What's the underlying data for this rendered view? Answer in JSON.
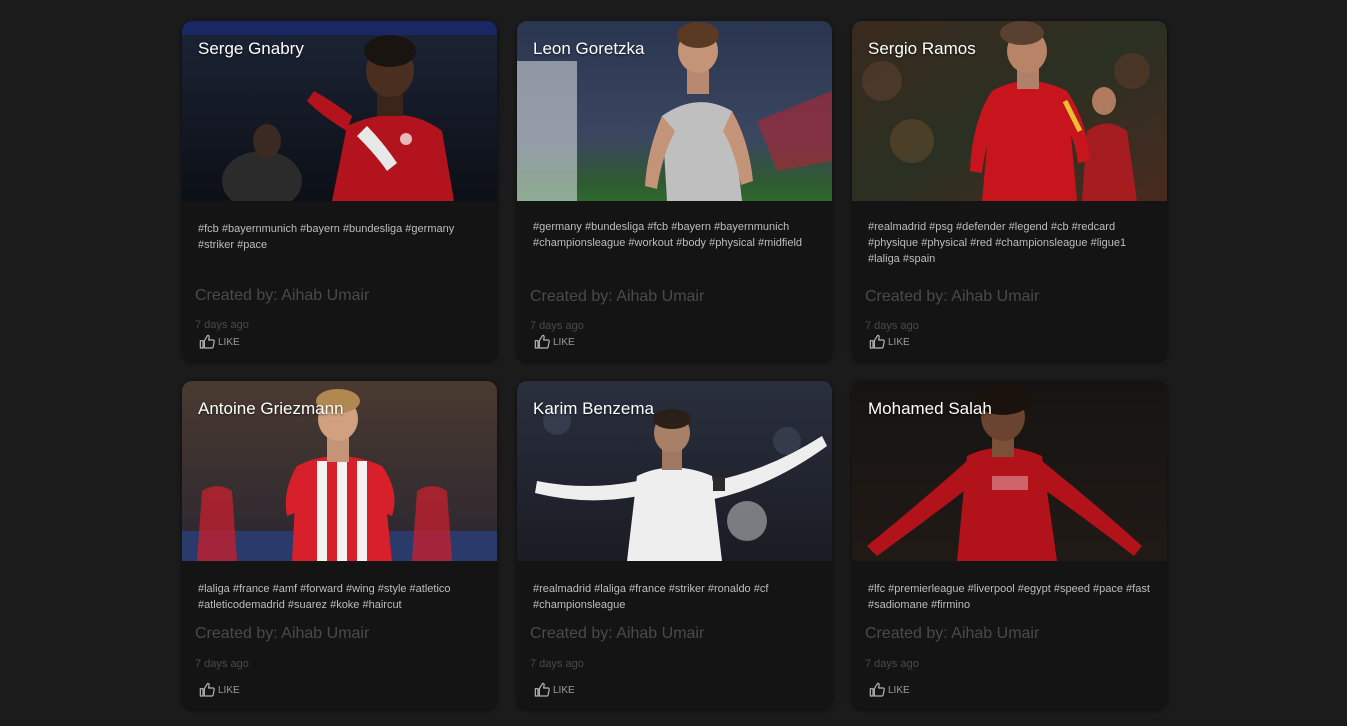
{
  "created_prefix": "Created by: ",
  "like_label": "LIKE",
  "cards": [
    {
      "title": "Serge Gnabry",
      "tags": "#fcb #bayernmunich #bayern #bundesliga #germany #striker #pace",
      "creator": "Created by: Aihab Umair",
      "ago": "7 days ago",
      "image": "soccer player in red Bayern kit gesturing"
    },
    {
      "title": "Leon Goretzka",
      "tags": "#germany #bundesliga #fcb #bayern #bayernmunich #championsleague #workout #body #physical #midfield",
      "creator": "Created by: Aihab Umair",
      "ago": "7 days ago",
      "image": "soccer player in grey away kit"
    },
    {
      "title": "Sergio Ramos",
      "tags": "#realmadrid #psg #defender #legend #cb #redcard #physique #physical #red #championsleague #ligue1 #laliga #spain",
      "creator": "Created by: Aihab Umair",
      "ago": "7 days ago",
      "image": "soccer player in red Spain kit celebrating"
    },
    {
      "title": "Antoine Griezmann",
      "tags": "#laliga #france #amf #forward #wing #style #atletico #atleticodemadrid #suarez #koke #haircut",
      "creator": "Created by: Aihab Umair",
      "ago": "7 days ago",
      "image": "soccer player in red and white striped kit"
    },
    {
      "title": "Karim Benzema",
      "tags": "#realmadrid #laliga #france #striker #ronaldo #cf #championsleague",
      "creator": "Created by: Aihab Umair",
      "ago": "7 days ago",
      "image": "soccer player in white kit with arms spread"
    },
    {
      "title": "Mohamed Salah",
      "tags": "#lfc #premierleague #liverpool #egypt #speed #pace #fast #sadiomane #firmino",
      "creator": "Created by: Aihab Umair",
      "ago": "7 days ago",
      "image": "soccer player in red Liverpool kit celebrating"
    }
  ],
  "colors": {
    "background": "#1b1b1b",
    "card": "#141414",
    "muted_text": "#4a4a4a",
    "tag_text": "#bdbdbd"
  }
}
